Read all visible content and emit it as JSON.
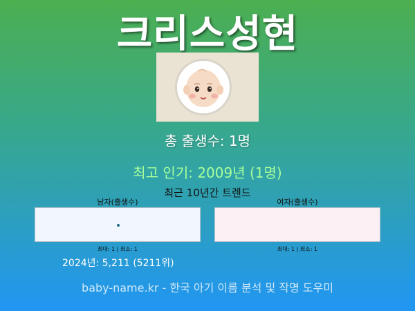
{
  "name_title": "크리스성현",
  "baby_image": {
    "icon": "baby-face-icon"
  },
  "stats": {
    "total_births": "총 출생수: 1명",
    "most_popular": "최고 인기: 2009년 (1명)"
  },
  "trend": {
    "title": "최근 10년간 트렌드",
    "male": {
      "label": "남자(출생수)",
      "minmax": "최대: 1 | 최소: 1",
      "color": "#1f6f8a"
    },
    "female": {
      "label": "여자(출생수)",
      "minmax": "최대: 1 | 최소: 1",
      "color": "#e86a9a"
    }
  },
  "rank_2024": "2024년: 5,211 (5211위)",
  "footer": "baby-name.kr - 한국 아기 이름 분석 및 작명 도우미",
  "colors": {
    "gradient_top": "#4caf50",
    "gradient_bottom": "#2196f3",
    "popular_text": "#a8ff9a"
  }
}
